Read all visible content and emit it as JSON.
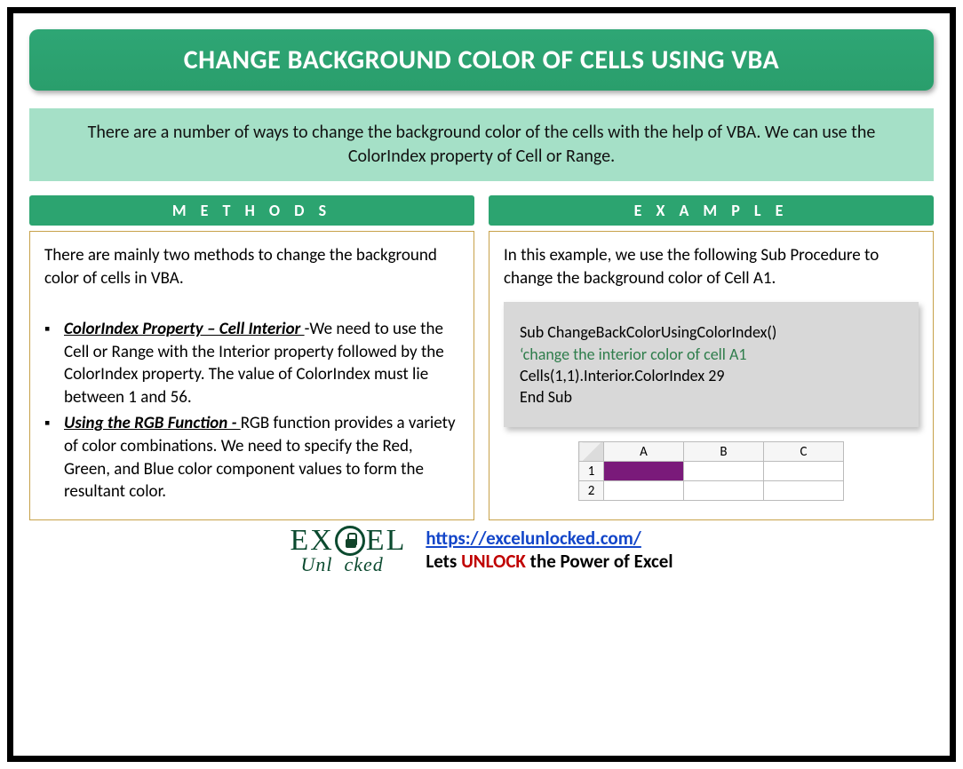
{
  "title": "CHANGE BACKGROUND COLOR OF CELLS USING VBA",
  "intro": "There are a number of ways to change the background color of the cells with the help of VBA. We can use the ColorIndex property of Cell or Range.",
  "methods": {
    "heading": "M E T H O D S",
    "lead": "There are mainly two methods to change the background color of cells in VBA.",
    "items": [
      {
        "term": "ColorIndex Property – Cell Interior ",
        "desc": "-We need to use the Cell or Range with the Interior property followed by the ColorIndex property. The value of ColorIndex must lie between 1 and 56."
      },
      {
        "term": "Using the RGB Function - ",
        "desc": "RGB function provides a variety of color combinations. We need to specify the Red, Green, and Blue color component values to form the resultant color."
      }
    ]
  },
  "example": {
    "heading": "E X A M P L E",
    "lead": "In this example, we use the following Sub Procedure to change the background color of Cell A1.",
    "code": {
      "line1": "Sub ChangeBackColorUsingColorIndex()",
      "line2": "‘change the interior color of cell A1",
      "line3": "Cells(1,1).Interior.ColorIndex 29",
      "line4": "End Sub"
    },
    "grid": {
      "cols": [
        "A",
        "B",
        "C"
      ],
      "rows": [
        "1",
        "2"
      ],
      "filled_cell_color": "#7a1a7a"
    }
  },
  "footer": {
    "logo_top": "EX  EL",
    "logo_bottom": "Unl  cked",
    "url_text": "https://excelunlocked.com/",
    "tagline_pre": "Lets ",
    "tagline_em": "UNLOCK",
    "tagline_post": " the Power of Excel"
  }
}
